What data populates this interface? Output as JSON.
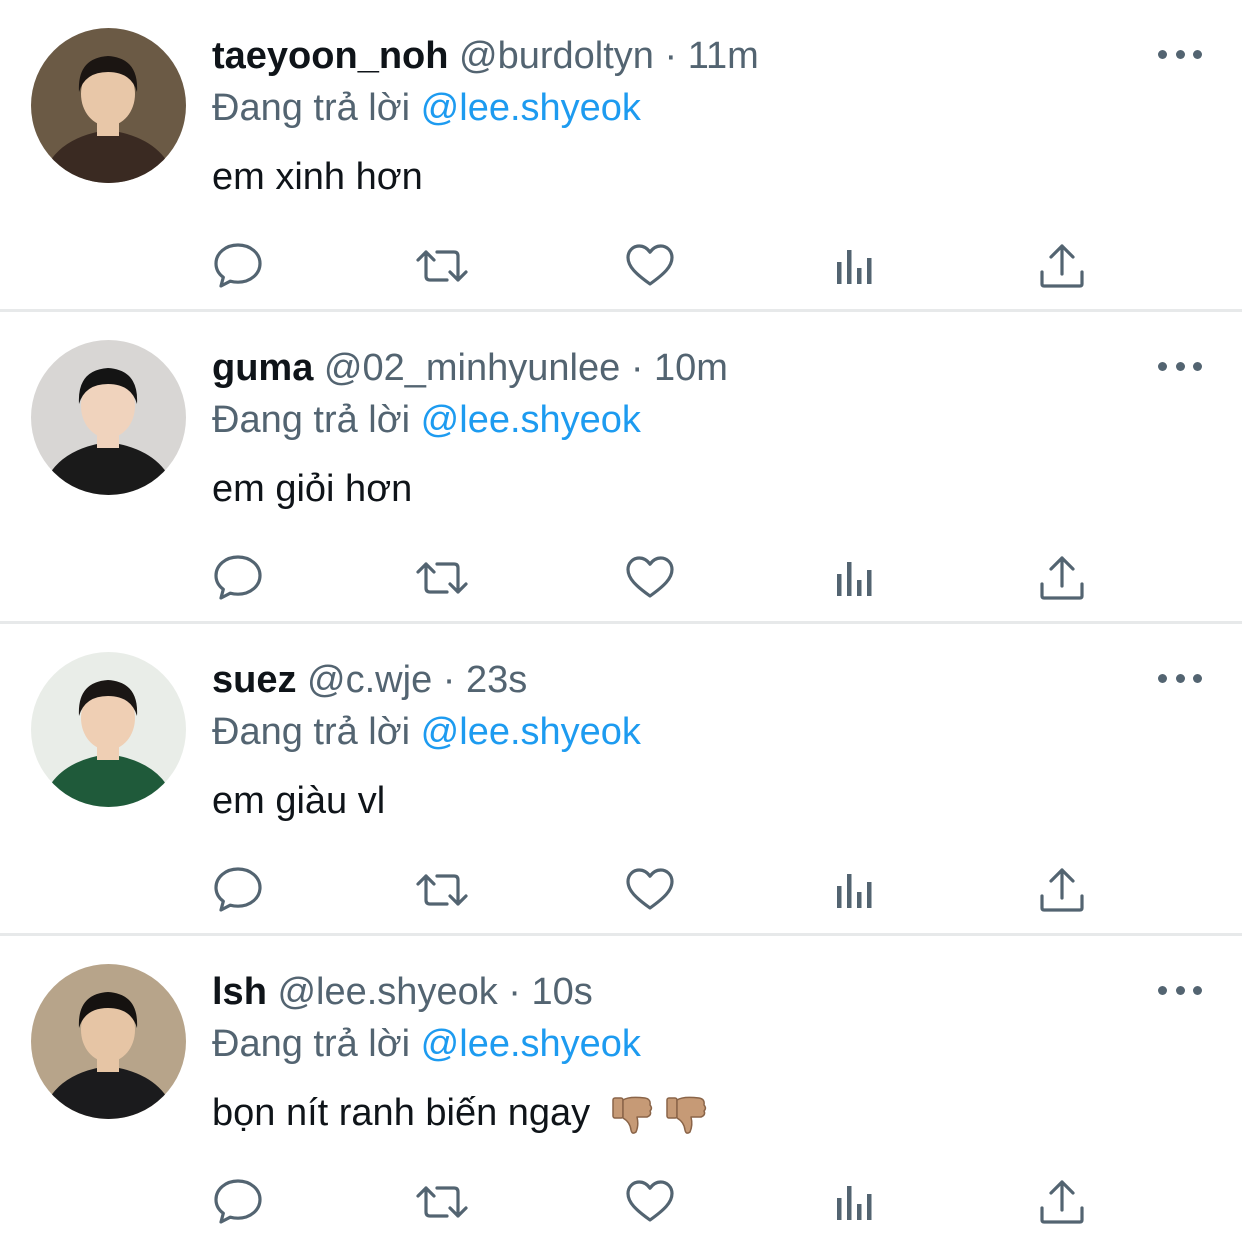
{
  "tweets": [
    {
      "name": "taeyoon_noh",
      "handle": "@burdoltyn",
      "sep": "·",
      "time": "11m",
      "reply_prefix": "Đang trả lời",
      "reply_to": "@lee.shyeok",
      "text": "em xinh hơn",
      "avatar_colors": {
        "bg": "#6b5a45",
        "skin": "#e8c7a8",
        "hair": "#1b1512",
        "shirt": "#3a2a22"
      }
    },
    {
      "name": "guma",
      "handle": "@02_minhyunlee",
      "sep": "·",
      "time": "10m",
      "reply_prefix": "Đang trả lời",
      "reply_to": "@lee.shyeok",
      "text": "em giỏi hơn",
      "avatar_colors": {
        "bg": "#d8d6d4",
        "skin": "#f0d3bd",
        "hair": "#141414",
        "shirt": "#1a1a1a"
      }
    },
    {
      "name": "suez",
      "handle": "@c.wje",
      "sep": "·",
      "time": "23s",
      "reply_prefix": "Đang trả lời",
      "reply_to": "@lee.shyeok",
      "text": "em giàu vl",
      "avatar_colors": {
        "bg": "#e9ede8",
        "skin": "#efcfb4",
        "hair": "#1a1614",
        "shirt": "#1f5a3a"
      }
    },
    {
      "name": "lsh",
      "handle": "@lee.shyeok",
      "sep": "·",
      "time": "10s",
      "reply_prefix": "Đang trả lời",
      "reply_to": "@lee.shyeok",
      "text": "bọn nít ranh biến ngay",
      "emoji": [
        "thumbs-down",
        "thumbs-down"
      ],
      "avatar_colors": {
        "bg": "#b7a48a",
        "skin": "#e6c5a5",
        "hair": "#151210",
        "shirt": "#1b1b1d"
      }
    }
  ],
  "icons": {
    "reply": "comment-icon",
    "retweet": "retweet-icon",
    "like": "heart-icon",
    "views": "analytics-icon",
    "share": "share-icon",
    "more": "more-icon"
  },
  "colors": {
    "text": "#0f1419",
    "secondary": "#536471",
    "link": "#1d9bf0",
    "divider": "#e7e9ea",
    "emoji": "#c69a76"
  }
}
